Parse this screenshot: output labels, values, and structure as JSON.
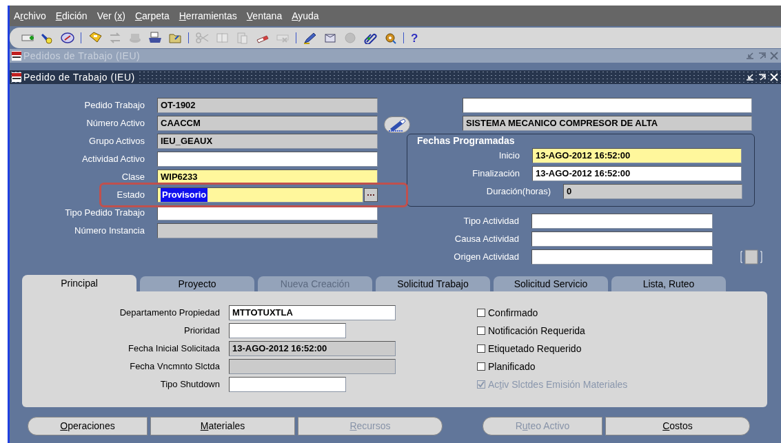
{
  "menu": [
    {
      "label_parts": [
        {
          "text": "A"
        },
        {
          "text": "r",
          "underlined": true
        },
        {
          "text": "chivo"
        }
      ]
    },
    {
      "label_parts": [
        {
          "text": "E",
          "underlined": true
        },
        {
          "text": "dición"
        }
      ]
    },
    {
      "label_parts": [
        {
          "text": "Ver ("
        },
        {
          "text": "x",
          "underlined": true
        },
        {
          "text": ")"
        }
      ]
    },
    {
      "label_parts": [
        {
          "text": "C",
          "underlined": true
        },
        {
          "text": "arpeta"
        }
      ]
    },
    {
      "label_parts": [
        {
          "text": "H",
          "underlined": true
        },
        {
          "text": "erramientas"
        }
      ]
    },
    {
      "label_parts": [
        {
          "text": "V",
          "underlined": true
        },
        {
          "text": "entana"
        }
      ]
    },
    {
      "label_parts": [
        {
          "text": "A",
          "underlined": true
        },
        {
          "text": "yuda"
        }
      ]
    }
  ],
  "toolbar": [
    {
      "kind": "button",
      "disabled": false
    },
    {
      "kind": "button",
      "disabled": false
    },
    {
      "kind": "button",
      "disabled": false
    },
    {
      "kind": "separator"
    },
    {
      "kind": "button",
      "disabled": false
    },
    {
      "kind": "button",
      "disabled": true
    },
    {
      "kind": "button",
      "disabled": true
    },
    {
      "kind": "button",
      "disabled": false
    },
    {
      "kind": "button",
      "disabled": false
    },
    {
      "kind": "separator"
    },
    {
      "kind": "button",
      "disabled": true
    },
    {
      "kind": "button",
      "disabled": true
    },
    {
      "kind": "button",
      "disabled": true
    },
    {
      "kind": "button",
      "disabled": false
    },
    {
      "kind": "button",
      "disabled": true
    },
    {
      "kind": "separator"
    },
    {
      "kind": "button",
      "disabled": false
    },
    {
      "kind": "button",
      "disabled": false
    },
    {
      "kind": "button",
      "disabled": true
    },
    {
      "kind": "button",
      "disabled": false
    },
    {
      "kind": "button",
      "disabled": false
    },
    {
      "kind": "separator"
    },
    {
      "kind": "help",
      "text": "?"
    }
  ],
  "outer_window": {
    "title": "Pedidos de Trabajo (IEU)",
    "active": false
  },
  "inner_window": {
    "title": "Pedido de Trabajo (IEU)",
    "active": true
  },
  "header_fields": [
    {
      "label": "Pedido Trabajo",
      "value": "OT-1902",
      "readonly": true
    },
    {
      "label": "Número Activo",
      "value": "CAACCM",
      "readonly": true
    },
    {
      "label": "Grupo Activos",
      "value": "IEU_GEAUX",
      "readonly": true
    },
    {
      "label": "Actividad Activo",
      "readonly": false,
      "required": false
    },
    {
      "label": "Clase",
      "value": "WIP6233",
      "readonly": false,
      "required": true
    },
    {
      "label": "Estado",
      "value": "Provisorio",
      "readonly": false,
      "required": true,
      "selected": true,
      "lov": true,
      "highlighted": true
    },
    {
      "label": "Tipo Pedido Trabajo",
      "readonly": false,
      "required": false
    },
    {
      "label": "Número Instancia",
      "readonly": true
    }
  ],
  "asset_description": {
    "top_field": {
      "readonly": false,
      "required": false
    },
    "description": {
      "value": "SISTEMA MECANICO COMPRESOR DE ALTA",
      "readonly": true
    }
  },
  "scheduled_dates": {
    "title": "Fechas Programadas",
    "fields": [
      {
        "label": "Inicio",
        "value": "13-AGO-2012 16:52:00",
        "readonly": false,
        "required": true
      },
      {
        "label": "Finalización",
        "value": "13-AGO-2012 16:52:00",
        "readonly": false,
        "required": false
      },
      {
        "label": "Duración(horas)",
        "value": "0",
        "readonly": true
      }
    ]
  },
  "activity_fields": [
    {
      "label": "Tipo Actividad",
      "readonly": false,
      "required": false
    },
    {
      "label": "Causa Actividad",
      "readonly": false,
      "required": false
    },
    {
      "label": "Origen Actividad",
      "readonly": false,
      "required": false
    }
  ],
  "tabs": [
    {
      "label": "Principal",
      "selected": true,
      "disabled": false
    },
    {
      "label": "Proyecto",
      "selected": false,
      "disabled": false
    },
    {
      "label": "Nueva Creación",
      "selected": false,
      "disabled": true
    },
    {
      "label": "Solicitud Trabajo",
      "selected": false,
      "disabled": false
    },
    {
      "label": "Solicitud Servicio",
      "selected": false,
      "disabled": false
    },
    {
      "label": "Lista, Ruteo",
      "selected": false,
      "disabled": false
    }
  ],
  "main_fields": [
    {
      "label": "Departamento Propiedad",
      "value": "MTTOTUXTLA",
      "readonly": false,
      "required": false,
      "wide": true
    },
    {
      "label": "Prioridad",
      "readonly": false,
      "required": false,
      "wide": false
    },
    {
      "label": "Fecha Inicial Solicitada",
      "value": "13-AGO-2012 16:52:00",
      "readonly": true,
      "wide": true
    },
    {
      "label": "Fecha Vncmnto Slctda",
      "readonly": true,
      "wide": true
    },
    {
      "label": "Tipo Shutdown",
      "readonly": false,
      "required": false,
      "wide": false
    }
  ],
  "checkboxes": [
    {
      "label_parts": [
        {
          "text": "Confirmado"
        }
      ],
      "checked": false,
      "disabled": false
    },
    {
      "label_parts": [
        {
          "text": "Notificación Requerida"
        }
      ],
      "checked": false,
      "disabled": false
    },
    {
      "label_parts": [
        {
          "text": "Etiquetado Requerido"
        }
      ],
      "checked": false,
      "disabled": false
    },
    {
      "label_parts": [
        {
          "text": "Planificado"
        }
      ],
      "checked": false,
      "disabled": false
    },
    {
      "label_parts": [
        {
          "text": "Ac"
        },
        {
          "text": "t",
          "underlined": true
        },
        {
          "text": "iv Slctdes Emisión Materiales"
        }
      ],
      "checked": true,
      "disabled": true
    }
  ],
  "buttons": [
    {
      "label_parts": [
        {
          "text": "O",
          "underlined": true
        },
        {
          "text": "peraciones"
        }
      ],
      "disabled": false,
      "gap_before": false
    },
    {
      "label_parts": [
        {
          "text": "M",
          "underlined": true
        },
        {
          "text": "ateriales"
        }
      ],
      "disabled": false,
      "gap_before": false
    },
    {
      "label_parts": [
        {
          "text": "R",
          "underlined": true
        },
        {
          "text": "ecursos"
        }
      ],
      "disabled": true,
      "gap_before": false
    },
    {
      "label_parts": [
        {
          "text": "R"
        },
        {
          "text": "u",
          "underlined": true
        },
        {
          "text": "teo Activo"
        }
      ],
      "disabled": true,
      "gap_before": true
    },
    {
      "label_parts": [
        {
          "text": "C",
          "underlined": true
        },
        {
          "text": "ostos"
        }
      ],
      "disabled": false,
      "gap_before": false
    }
  ]
}
